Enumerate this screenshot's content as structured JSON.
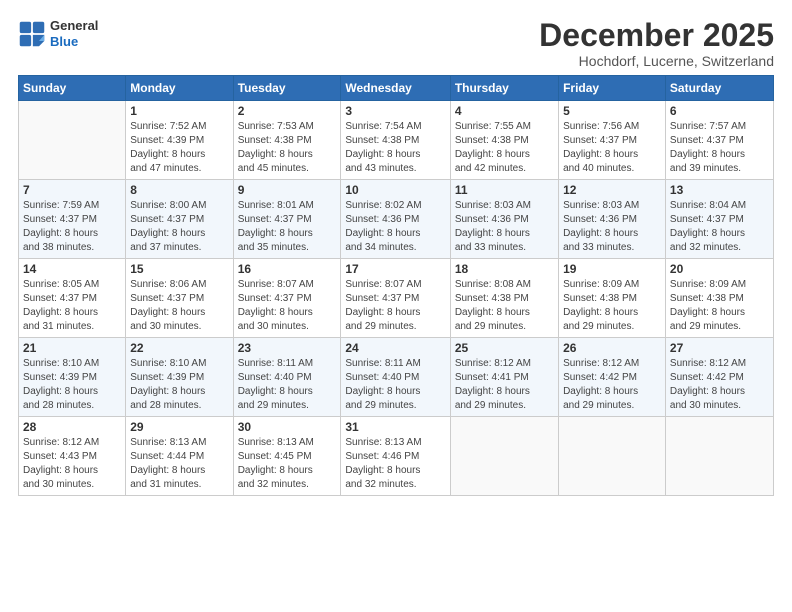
{
  "header": {
    "logo_general": "General",
    "logo_blue": "Blue",
    "title": "December 2025",
    "location": "Hochdorf, Lucerne, Switzerland"
  },
  "weekdays": [
    "Sunday",
    "Monday",
    "Tuesday",
    "Wednesday",
    "Thursday",
    "Friday",
    "Saturday"
  ],
  "weeks": [
    [
      {
        "day": "",
        "info": ""
      },
      {
        "day": "1",
        "info": "Sunrise: 7:52 AM\nSunset: 4:39 PM\nDaylight: 8 hours\nand 47 minutes."
      },
      {
        "day": "2",
        "info": "Sunrise: 7:53 AM\nSunset: 4:38 PM\nDaylight: 8 hours\nand 45 minutes."
      },
      {
        "day": "3",
        "info": "Sunrise: 7:54 AM\nSunset: 4:38 PM\nDaylight: 8 hours\nand 43 minutes."
      },
      {
        "day": "4",
        "info": "Sunrise: 7:55 AM\nSunset: 4:38 PM\nDaylight: 8 hours\nand 42 minutes."
      },
      {
        "day": "5",
        "info": "Sunrise: 7:56 AM\nSunset: 4:37 PM\nDaylight: 8 hours\nand 40 minutes."
      },
      {
        "day": "6",
        "info": "Sunrise: 7:57 AM\nSunset: 4:37 PM\nDaylight: 8 hours\nand 39 minutes."
      }
    ],
    [
      {
        "day": "7",
        "info": "Sunrise: 7:59 AM\nSunset: 4:37 PM\nDaylight: 8 hours\nand 38 minutes."
      },
      {
        "day": "8",
        "info": "Sunrise: 8:00 AM\nSunset: 4:37 PM\nDaylight: 8 hours\nand 37 minutes."
      },
      {
        "day": "9",
        "info": "Sunrise: 8:01 AM\nSunset: 4:37 PM\nDaylight: 8 hours\nand 35 minutes."
      },
      {
        "day": "10",
        "info": "Sunrise: 8:02 AM\nSunset: 4:36 PM\nDaylight: 8 hours\nand 34 minutes."
      },
      {
        "day": "11",
        "info": "Sunrise: 8:03 AM\nSunset: 4:36 PM\nDaylight: 8 hours\nand 33 minutes."
      },
      {
        "day": "12",
        "info": "Sunrise: 8:03 AM\nSunset: 4:36 PM\nDaylight: 8 hours\nand 33 minutes."
      },
      {
        "day": "13",
        "info": "Sunrise: 8:04 AM\nSunset: 4:37 PM\nDaylight: 8 hours\nand 32 minutes."
      }
    ],
    [
      {
        "day": "14",
        "info": "Sunrise: 8:05 AM\nSunset: 4:37 PM\nDaylight: 8 hours\nand 31 minutes."
      },
      {
        "day": "15",
        "info": "Sunrise: 8:06 AM\nSunset: 4:37 PM\nDaylight: 8 hours\nand 30 minutes."
      },
      {
        "day": "16",
        "info": "Sunrise: 8:07 AM\nSunset: 4:37 PM\nDaylight: 8 hours\nand 30 minutes."
      },
      {
        "day": "17",
        "info": "Sunrise: 8:07 AM\nSunset: 4:37 PM\nDaylight: 8 hours\nand 29 minutes."
      },
      {
        "day": "18",
        "info": "Sunrise: 8:08 AM\nSunset: 4:38 PM\nDaylight: 8 hours\nand 29 minutes."
      },
      {
        "day": "19",
        "info": "Sunrise: 8:09 AM\nSunset: 4:38 PM\nDaylight: 8 hours\nand 29 minutes."
      },
      {
        "day": "20",
        "info": "Sunrise: 8:09 AM\nSunset: 4:38 PM\nDaylight: 8 hours\nand 29 minutes."
      }
    ],
    [
      {
        "day": "21",
        "info": "Sunrise: 8:10 AM\nSunset: 4:39 PM\nDaylight: 8 hours\nand 28 minutes."
      },
      {
        "day": "22",
        "info": "Sunrise: 8:10 AM\nSunset: 4:39 PM\nDaylight: 8 hours\nand 28 minutes."
      },
      {
        "day": "23",
        "info": "Sunrise: 8:11 AM\nSunset: 4:40 PM\nDaylight: 8 hours\nand 29 minutes."
      },
      {
        "day": "24",
        "info": "Sunrise: 8:11 AM\nSunset: 4:40 PM\nDaylight: 8 hours\nand 29 minutes."
      },
      {
        "day": "25",
        "info": "Sunrise: 8:12 AM\nSunset: 4:41 PM\nDaylight: 8 hours\nand 29 minutes."
      },
      {
        "day": "26",
        "info": "Sunrise: 8:12 AM\nSunset: 4:42 PM\nDaylight: 8 hours\nand 29 minutes."
      },
      {
        "day": "27",
        "info": "Sunrise: 8:12 AM\nSunset: 4:42 PM\nDaylight: 8 hours\nand 30 minutes."
      }
    ],
    [
      {
        "day": "28",
        "info": "Sunrise: 8:12 AM\nSunset: 4:43 PM\nDaylight: 8 hours\nand 30 minutes."
      },
      {
        "day": "29",
        "info": "Sunrise: 8:13 AM\nSunset: 4:44 PM\nDaylight: 8 hours\nand 31 minutes."
      },
      {
        "day": "30",
        "info": "Sunrise: 8:13 AM\nSunset: 4:45 PM\nDaylight: 8 hours\nand 32 minutes."
      },
      {
        "day": "31",
        "info": "Sunrise: 8:13 AM\nSunset: 4:46 PM\nDaylight: 8 hours\nand 32 minutes."
      },
      {
        "day": "",
        "info": ""
      },
      {
        "day": "",
        "info": ""
      },
      {
        "day": "",
        "info": ""
      }
    ]
  ]
}
